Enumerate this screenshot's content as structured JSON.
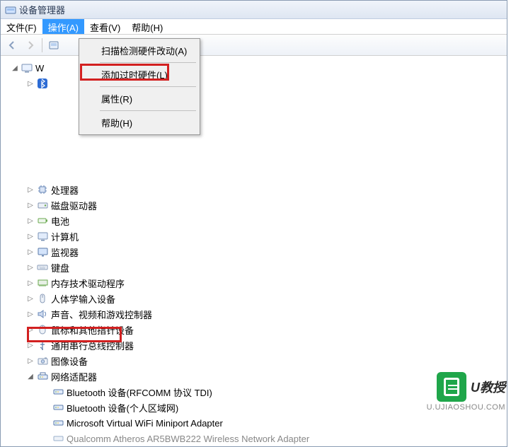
{
  "window": {
    "title": "设备管理器"
  },
  "menubar": {
    "file": "文件(F)",
    "action": "操作(A)",
    "view": "查看(V)",
    "help": "帮助(H)"
  },
  "dropdown": {
    "scan": "扫描检测硬件改动(A)",
    "addLegacy": "添加过时硬件(L)",
    "properties": "属性(R)",
    "help": "帮助(H)"
  },
  "tree": {
    "root": "W",
    "items": [
      "处理器",
      "磁盘驱动器",
      "电池",
      "计算机",
      "监视器",
      "键盘",
      "内存技术驱动程序",
      "人体学输入设备",
      "声音、视频和游戏控制器",
      "鼠标和其他指针设备",
      "通用串行总线控制器",
      "图像设备"
    ],
    "networkAdapter": "网络适配器",
    "networkChildren": [
      "Bluetooth 设备(RFCOMM 协议 TDI)",
      "Bluetooth 设备(个人区域网)",
      "Microsoft Virtual WiFi Miniport Adapter",
      "Qualcomm Atheros AR5BWB222 Wireless Network Adapter"
    ]
  },
  "watermark": {
    "brand": "U教授",
    "url": "U.UJIAOSHOU.COM"
  }
}
